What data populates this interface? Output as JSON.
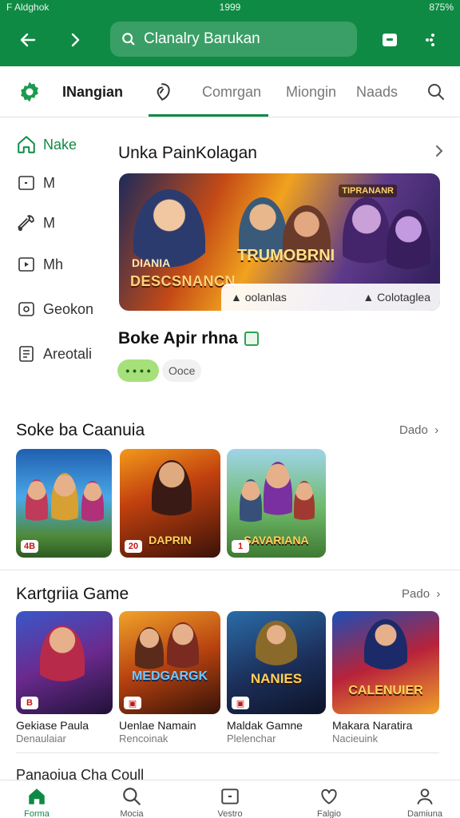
{
  "status_bar": {
    "left": "F Aldghok",
    "center": "1999",
    "right": "875%"
  },
  "app_bar": {
    "search_placeholder": "Clanalry Barukan"
  },
  "tabs": {
    "title": "INangian",
    "items": [
      "Comrgan",
      "Miongin",
      "Naads"
    ]
  },
  "rail": {
    "items": [
      {
        "label": "Nake",
        "icon": "home-icon",
        "active": true
      },
      {
        "label": "M",
        "icon": "tile-icon",
        "active": false
      },
      {
        "label": "M",
        "icon": "wrench-icon",
        "active": false
      },
      {
        "label": "Mh",
        "icon": "play-icon",
        "active": false
      },
      {
        "label": "Geokon",
        "icon": "eye-icon",
        "active": false
      },
      {
        "label": "Areotali",
        "icon": "document-icon",
        "active": false
      }
    ]
  },
  "featured": {
    "section_title": "Unka PainKolagan",
    "banner": {
      "title_art_line1": "DIANIA",
      "title_art_line2": "DESCSNANCN",
      "logo_art": "TRUMOBRNI",
      "corner_tag": "TIPRANANR",
      "overlay_left": "oolanlas",
      "overlay_right": "Colotaglea"
    },
    "app_name": "Boke Apir rhna",
    "rating_pill": "• • • •",
    "meta_pill": "Ooce"
  },
  "section1": {
    "title": "Soke ba Caanuia",
    "more": "Dado",
    "thumbs": [
      {
        "label": "",
        "rank": "4B"
      },
      {
        "label": "DAPRIN",
        "rank": "20"
      },
      {
        "label": "SAVARIANA",
        "rank": "1"
      }
    ]
  },
  "section2": {
    "title": "Kartgriia Game",
    "more": "Pado",
    "games": [
      {
        "art": "",
        "title": "Gekiase Paula",
        "sub": "Denaulaiar",
        "rank": "B"
      },
      {
        "art": "MEDGARGK",
        "title": "Uenlae Namain",
        "sub": "Rencoinak",
        "rank": ""
      },
      {
        "art": "NANIES",
        "title": "Maldak Gamne",
        "sub": "Plelenchar",
        "rank": ""
      },
      {
        "art": "CALENUIER",
        "title": "Makara Naratira",
        "sub": "Nacieuink",
        "rank": ""
      }
    ]
  },
  "peek_section": {
    "title": "Panaoiua Cha Coull"
  },
  "bottom_nav": {
    "items": [
      {
        "label": "Forma",
        "icon": "home-icon",
        "active": true
      },
      {
        "label": "Mocia",
        "icon": "search-icon",
        "active": false
      },
      {
        "label": "Vestro",
        "icon": "tile-icon",
        "active": false
      },
      {
        "label": "Falgio",
        "icon": "heart-icon",
        "active": false
      },
      {
        "label": "Damiuna",
        "icon": "profile-icon",
        "active": false
      }
    ]
  },
  "colors": {
    "brand": "#0f8a45",
    "accent_pill": "#a6e07a"
  }
}
